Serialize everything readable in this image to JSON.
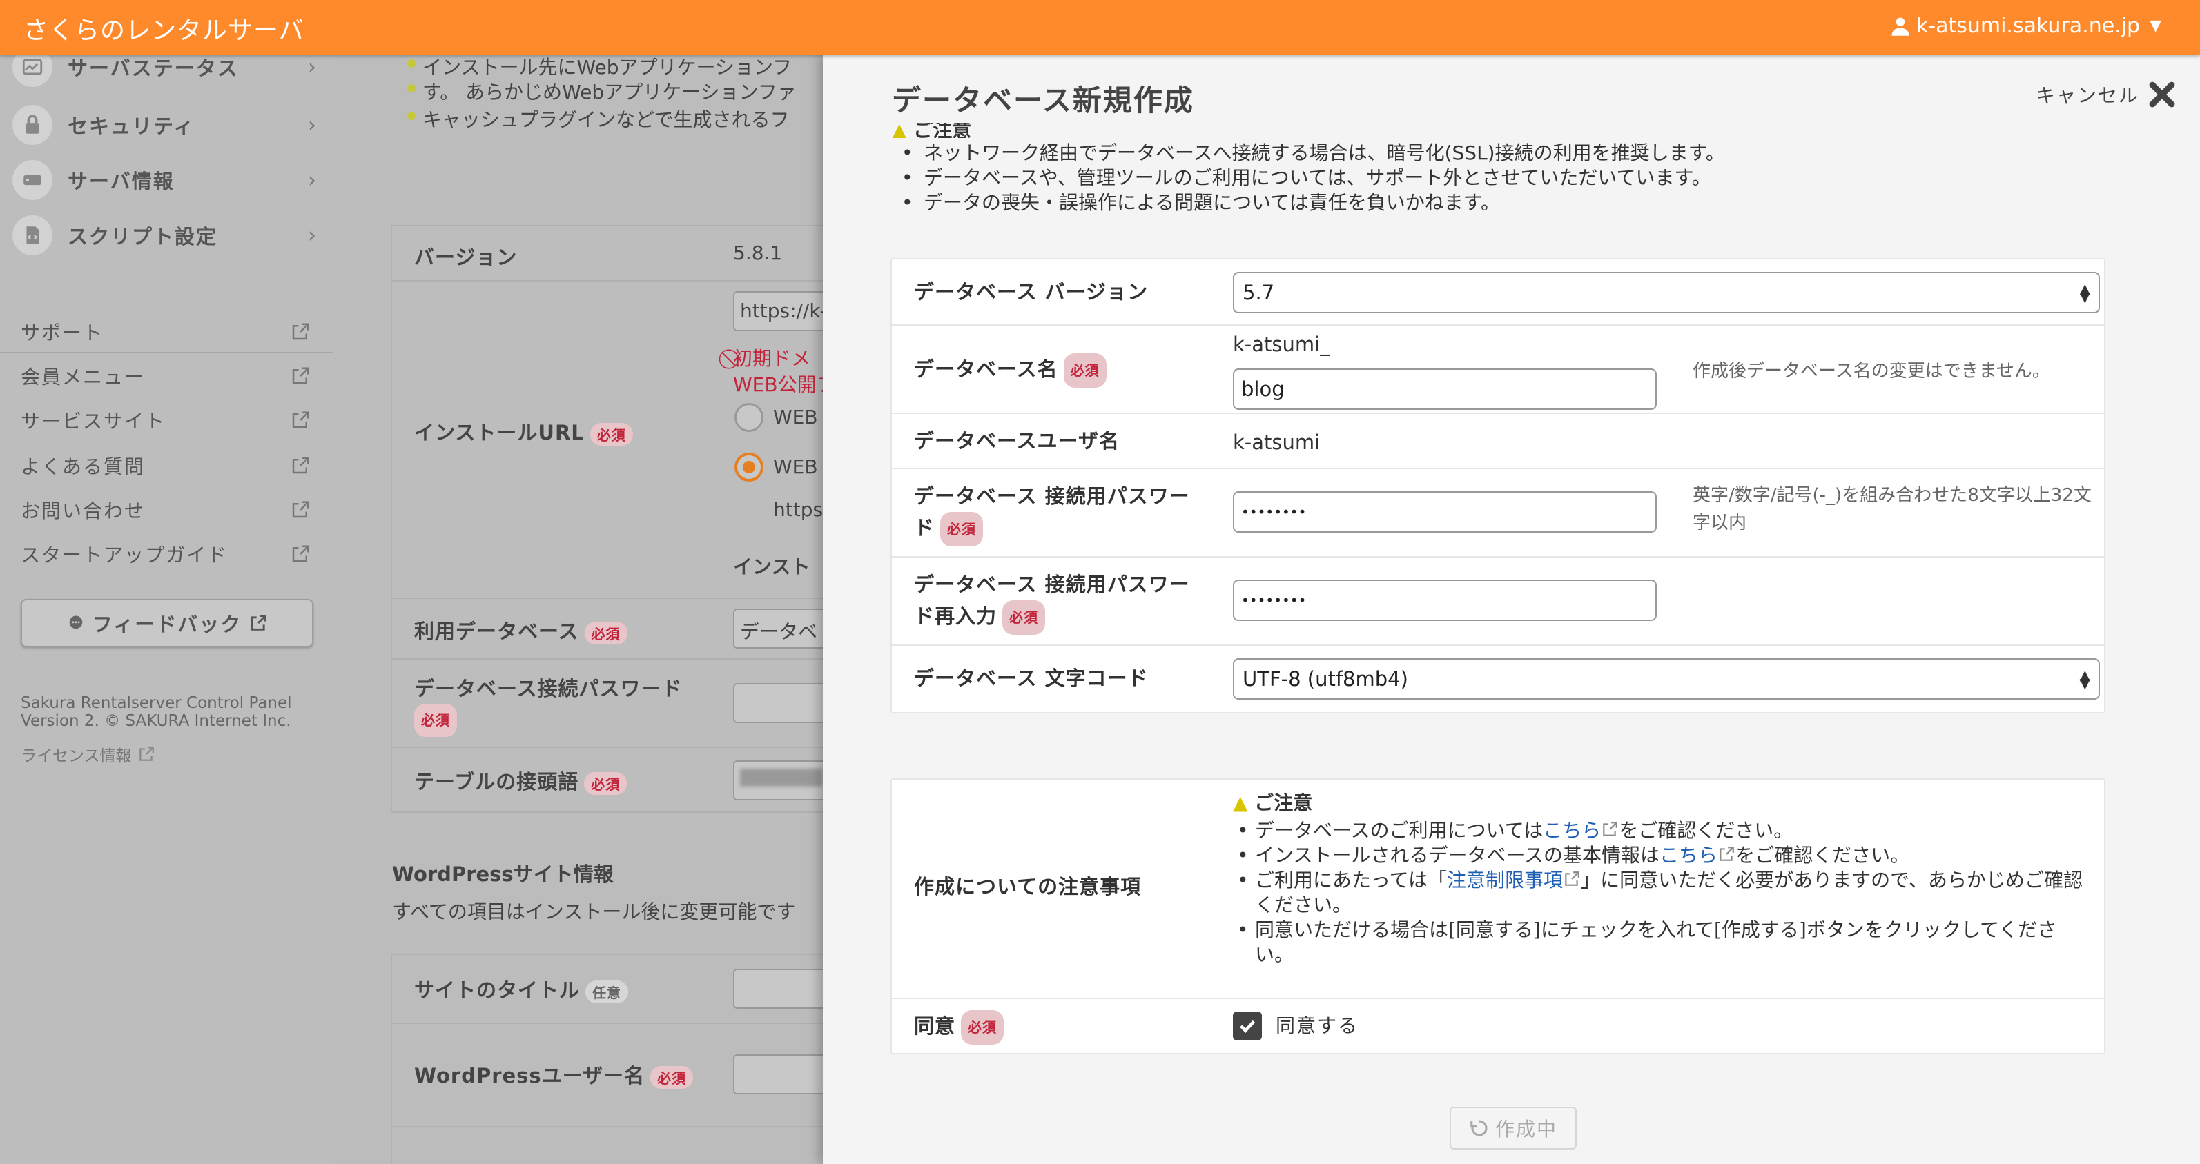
{
  "header": {
    "app_title": "さくらのレンタルサーバ",
    "user_account": "k-atsumi.sakura.ne.jp"
  },
  "sidebar": {
    "nav_items": [
      {
        "label": "サーバステータス",
        "icon": "chart-icon"
      },
      {
        "label": "セキュリティ",
        "icon": "lock-icon"
      },
      {
        "label": "サーバ情報",
        "icon": "server-icon"
      },
      {
        "label": "スクリプト設定",
        "icon": "script-icon"
      }
    ],
    "links": [
      {
        "label": "サポート"
      },
      {
        "label": "会員メニュー"
      },
      {
        "label": "サービスサイト"
      },
      {
        "label": "よくある質問"
      },
      {
        "label": "お問い合わせ"
      },
      {
        "label": "スタートアップガイド"
      }
    ],
    "feedback_label": "フィードバック",
    "copyright_line1": "Sakura Rentalserver Control Panel",
    "copyright_line2": "Version 2. © SAKURA Internet Inc.",
    "license_label": "ライセンス情報"
  },
  "background": {
    "bullets": [
      "インストール先にWebアプリケーションフ",
      "す。 あらかじめWebアプリケーションファ",
      "キャッシュプラグインなどで生成されるフ"
    ],
    "version_label": "バージョン",
    "version_value": "5.8.1",
    "install_url_label": "インストールURL",
    "install_url_value": "https://k-a",
    "warning_line1": "初期ドメ",
    "warning_line2": "WEB公開フ",
    "radio1_label": "WEB",
    "radio2_label": "WEB",
    "url_fragment": "https",
    "install_fragment": "インスト",
    "db_label": "利用データベース",
    "db_value": "データベ",
    "db_password_label": "データベース接続パスワード",
    "table_prefix_label": "テーブルの接頭語",
    "wp_section_title": "WordPressサイト情報",
    "wp_section_note": "すべての項目はインストール後に変更可能です",
    "site_title_label": "サイトのタイトル",
    "wp_user_label": "WordPressユーザー名",
    "required_badge": "必須",
    "optional_badge": "任意"
  },
  "modal": {
    "title": "データベース新規作成",
    "cancel_label": "キャンセル",
    "notice_heading_partial": "ご注意",
    "notice_items": [
      "ネットワーク経由でデータベースへ接続する場合は、暗号化(SSL)接続の利用を推奨します。",
      "データベースや、管理ツールのご利用については、サポート外とさせていただいています。",
      "データの喪失・誤操作による問題については責任を負いかねます。"
    ],
    "form": {
      "version_label": "データベース バージョン",
      "version_value": "5.7",
      "db_name_label": "データベース名",
      "db_name_prefix": "k-atsumi_",
      "db_name_value": "blog",
      "db_name_hint": "作成後データベース名の変更はできません。",
      "db_user_label": "データベースユーザ名",
      "db_user_value": "k-atsumi",
      "password_label_1": "データベース 接続用パスワー",
      "password_label_2": "ド",
      "password_value": "••••••••",
      "password_hint_1": "英字/数字/記号(-_)を組み合わせた8文字以上32文",
      "password_hint_2": "字以内",
      "password_confirm_label_1": "データベース 接続用パスワー",
      "password_confirm_label_2": "ド再入力",
      "password_confirm_value": "••••••••",
      "charset_label": "データベース 文字コード",
      "charset_value": "UTF-8 (utf8mb4)",
      "required_badge": "必須"
    },
    "caution": {
      "label": "作成についての注意事項",
      "heading": "ご注意",
      "items": [
        {
          "pre": "データベースのご利用については",
          "link": "こちら",
          "post": "をご確認ください。"
        },
        {
          "pre": "インストールされるデータベースの基本情報は",
          "link": "こちら",
          "post": "をご確認ください。"
        },
        {
          "pre": "ご利用にあたっては「",
          "link": "注意制限事項",
          "post": "」に同意いただく必要がありますので、あらかじめご確認ください。"
        },
        {
          "pre": "同意いただける場合は[同意する]にチェックを入れて[作成する]ボタンをクリックしてください。",
          "link": "",
          "post": ""
        }
      ],
      "agree_label": "同意",
      "agree_checkbox_label": "同意する",
      "agree_checked": true
    },
    "submit_label": "作成中"
  },
  "colors": {
    "accent": "#ff8a2b",
    "required": "#c2243c",
    "link": "#1f5fb2",
    "radio_on": "#e67e22"
  }
}
